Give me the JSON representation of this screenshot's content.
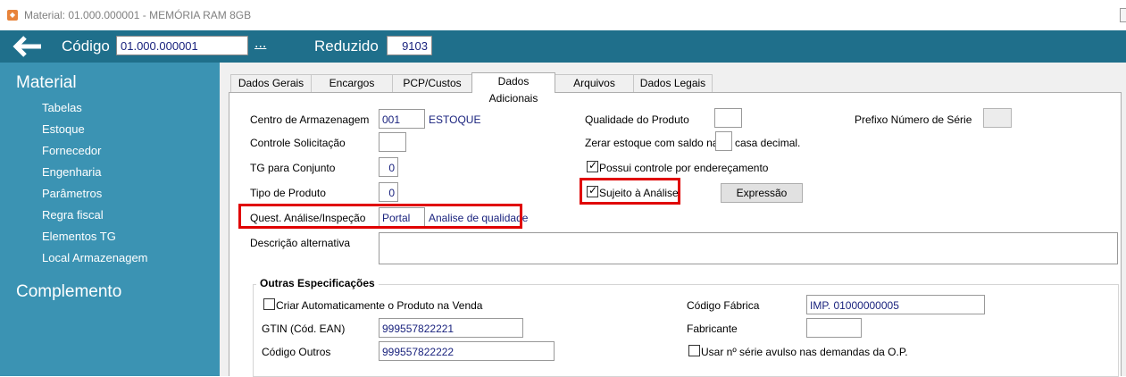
{
  "window": {
    "title": "Material: 01.000.000001 - MEMÓRIA RAM 8GB"
  },
  "header": {
    "codigo_label": "Código",
    "codigo_value": "01.000.000001",
    "dots": "...",
    "reduzido_label": "Reduzido",
    "reduzido_value": "9103"
  },
  "sidebar": {
    "section1": "Material",
    "items": [
      "Tabelas",
      "Estoque",
      "Fornecedor",
      "Engenharia",
      "Parâmetros",
      "Regra fiscal",
      "Elementos TG",
      "Local Armazenagem"
    ],
    "section2": "Complemento"
  },
  "tabs": [
    "Dados Gerais",
    "Encargos",
    "PCP/Custos",
    "Dados Adicionais",
    "Arquivos",
    "Dados Legais"
  ],
  "active_tab": "Dados Adicionais",
  "form": {
    "centro_label": "Centro de Armazenagem",
    "centro_value": "001",
    "centro_desc": "ESTOQUE",
    "controle_label": "Controle Solicitação",
    "controle_value": "",
    "tg_label": "TG para Conjunto",
    "tg_value": "0",
    "tipo_label": "Tipo de Produto",
    "tipo_value": "0",
    "quest_label": "Quest. Análise/Inspeção",
    "quest_value": "Portal",
    "quest_desc": "Analise de qualidade",
    "descr_label": "Descrição alternativa",
    "descr_value": "",
    "qualidade_label": "Qualidade do Produto",
    "qualidade_value": "",
    "zerar_label": "Zerar estoque com saldo na",
    "zerar_value": "",
    "zerar_suffix": "casa decimal.",
    "possui_label": "Possui controle por endereçamento",
    "possui_checked": true,
    "sujeito_label": "Sujeito à Análise",
    "sujeito_checked": true,
    "expressao_label": "Expressão",
    "prefixo_label": "Prefixo Número de Série",
    "prefixo_value": ""
  },
  "outras": {
    "title": "Outras Especificações",
    "criar_label": "Criar Automaticamente o Produto na Venda",
    "criar_checked": false,
    "gtin_label": "GTIN (Cód. EAN)",
    "gtin_value": "999557822221",
    "outros_label": "Código Outros",
    "outros_value": "999557822222",
    "fabrica_label": "Código Fábrica",
    "fabrica_value": "IMP. 01000000005",
    "fabricante_label": "Fabricante",
    "fabricante_value": "",
    "usar_label": "Usar nº série avulso nas demandas da O.P.",
    "usar_checked": false
  },
  "colors": {
    "header": "#1f6f8b",
    "sidebar": "#3b93b3",
    "highlight": "#e00000",
    "value_text": "#1a237e"
  }
}
